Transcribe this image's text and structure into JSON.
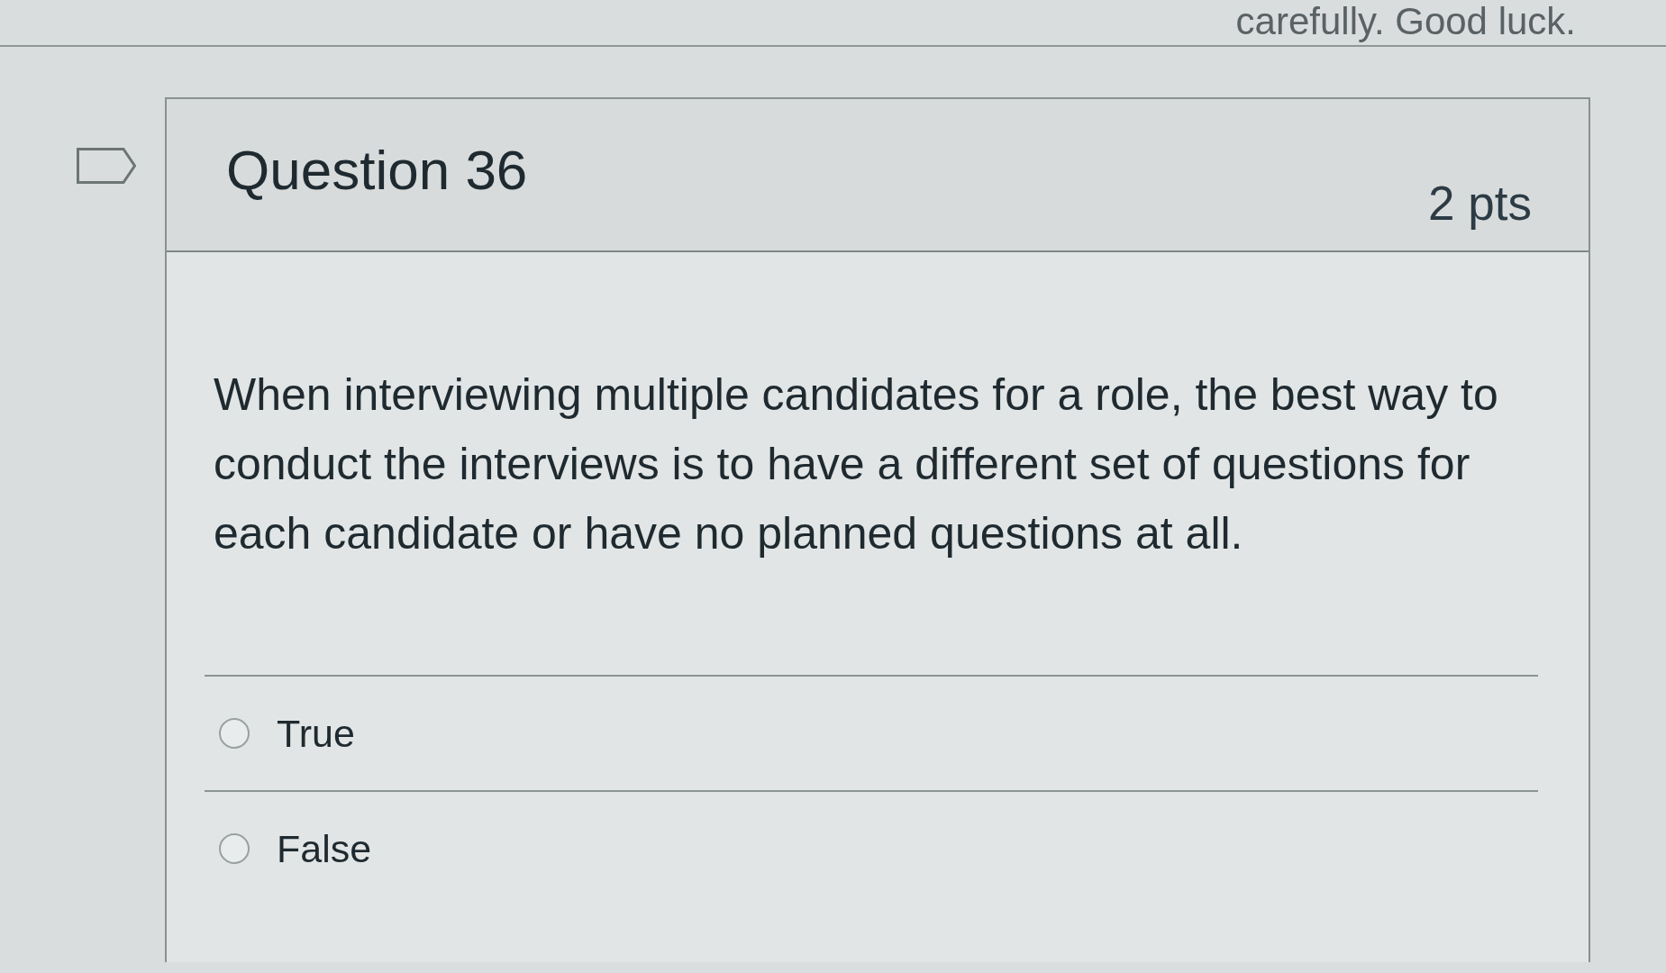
{
  "top_notice": {
    "text": "carefully. Good luck."
  },
  "question": {
    "flagged": false,
    "title": "Question 36",
    "points": "2 pts",
    "text": "When interviewing multiple candidates for a role, the best way to conduct the interviews is to have a different set of questions for each candidate or have no planned questions at all.",
    "answers": [
      {
        "label": "True",
        "selected": false
      },
      {
        "label": "False",
        "selected": false
      }
    ]
  }
}
